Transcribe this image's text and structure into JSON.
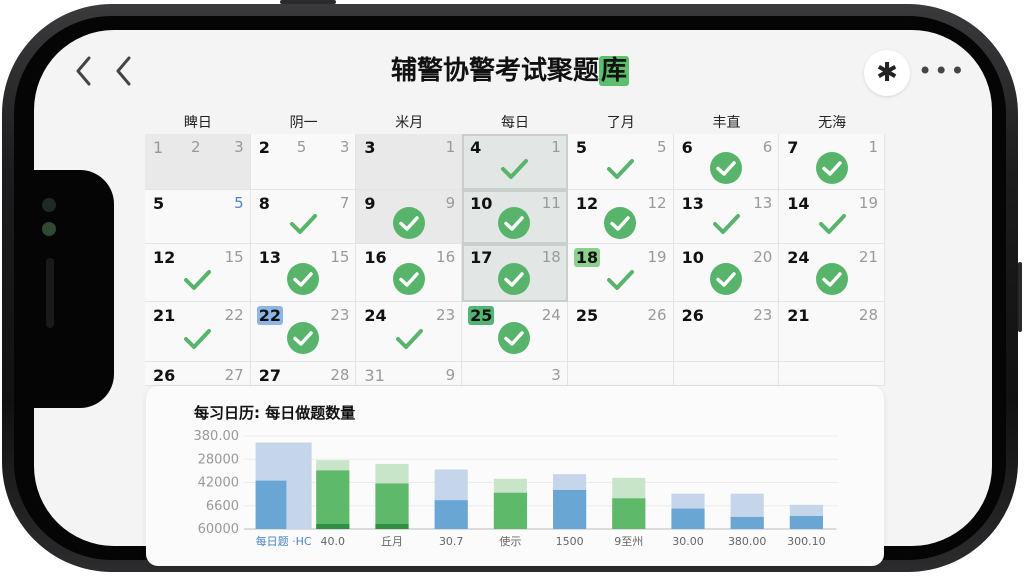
{
  "header": {
    "title_main": "辅警协警考试聚题",
    "title_highlight": "库",
    "action_icon": "✱",
    "more_icon": "•••"
  },
  "weekdays": [
    "睥日",
    "阴一",
    "米月",
    "每日",
    "了月",
    "丰直",
    "无海"
  ],
  "calendar": {
    "rows": [
      [
        {
          "day": "1",
          "mid": "2",
          "sub": "3",
          "faint": true,
          "style": "gray"
        },
        {
          "day": "2",
          "mid": "5",
          "sub": "3"
        },
        {
          "day": "3",
          "sub": "1",
          "style": "gray"
        },
        {
          "day": "4",
          "sub": "1",
          "check": "tick",
          "style": "sel"
        },
        {
          "day": "5",
          "sub": "5",
          "check": "tick"
        },
        {
          "day": "6",
          "sub": "6",
          "check": "circle"
        },
        {
          "day": "7",
          "sub": "1",
          "check": "circle"
        }
      ],
      [
        {
          "day": "5",
          "sub": "5",
          "subblue": true
        },
        {
          "day": "8",
          "sub": "7",
          "check": "tick"
        },
        {
          "day": "9",
          "sub": "9",
          "check": "circle",
          "style": "gray"
        },
        {
          "day": "10",
          "sub": "11",
          "check": "circle",
          "style": "sel"
        },
        {
          "day": "12",
          "sub": "12",
          "check": "circle"
        },
        {
          "day": "13",
          "sub": "13",
          "check": "tick"
        },
        {
          "day": "14",
          "sub": "19",
          "check": "tick"
        }
      ],
      [
        {
          "day": "12",
          "sub": "15",
          "check": "tick"
        },
        {
          "day": "13",
          "sub": "15",
          "check": "circle"
        },
        {
          "day": "16",
          "sub": "16",
          "check": "circle"
        },
        {
          "day": "17",
          "sub": "18",
          "check": "circle",
          "style": "sel"
        },
        {
          "day": "18",
          "sub": "19",
          "check": "tick",
          "hl": "green"
        },
        {
          "day": "10",
          "sub": "20",
          "check": "circle"
        },
        {
          "day": "24",
          "sub": "21",
          "check": "circle"
        }
      ],
      [
        {
          "day": "21",
          "sub": "22",
          "check": "tick"
        },
        {
          "day": "22",
          "sub": "23",
          "check": "circle",
          "hl": "blue"
        },
        {
          "day": "24",
          "sub": "23",
          "check": "tick"
        },
        {
          "day": "25",
          "sub": "24",
          "check": "circle",
          "hl": "dkgreen"
        },
        {
          "day": "25",
          "sub": "26"
        },
        {
          "day": "26",
          "sub": "23"
        },
        {
          "day": "21",
          "sub": "28"
        }
      ],
      [
        {
          "day": "26",
          "sub": "27"
        },
        {
          "day": "27",
          "sub": "28"
        },
        {
          "day": "31",
          "sub": "9",
          "faint": true
        },
        {
          "day": "",
          "sub": "3"
        },
        {
          "day": "",
          "sub": ""
        },
        {
          "day": "",
          "sub": ""
        },
        {
          "day": "",
          "sub": ""
        }
      ]
    ]
  },
  "chart_data": {
    "type": "bar",
    "title": "每习日历: 每日做题数量",
    "y_tick_labels": [
      "380.00",
      "28000",
      "42000",
      "6600",
      "60000"
    ],
    "ylim": [
      0,
      100
    ],
    "categories": [
      "每日题 ·HC",
      "40.0",
      "丘月",
      "30.7",
      "使示",
      "1500",
      "9至州",
      "30.00",
      "380.00",
      "300.10"
    ],
    "series": [
      {
        "values": [
          93,
          74,
          70,
          64,
          54,
          59,
          55,
          38,
          38,
          26
        ]
      },
      {
        "values": [
          52,
          63,
          49,
          31,
          39,
          42,
          33,
          22,
          13,
          14
        ]
      }
    ],
    "colors": {
      "light_blue": "#c5d6ea",
      "light_green": "#c8e4c9",
      "blue": "#6aa6d4",
      "green": "#5fb96a",
      "dark_green": "#2f8f45"
    }
  },
  "colors": {
    "accent_green": "#58b46b",
    "screen_bg": "#f4f4f5"
  }
}
